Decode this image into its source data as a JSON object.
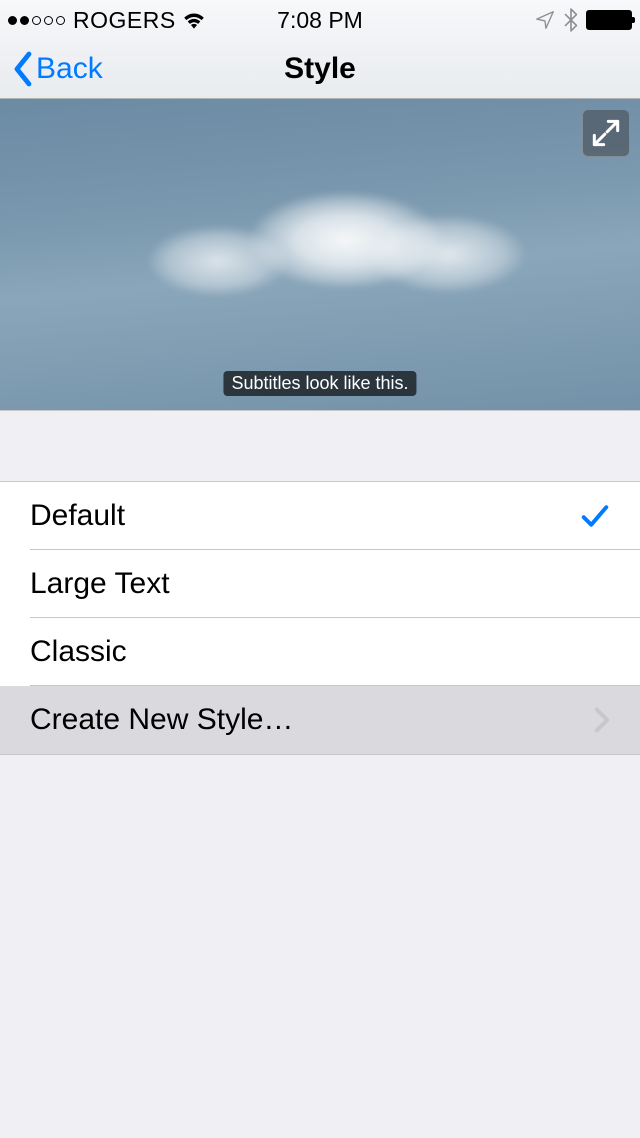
{
  "status": {
    "carrier": "ROGERS",
    "time": "7:08 PM"
  },
  "nav": {
    "back_label": "Back",
    "title": "Style"
  },
  "preview": {
    "subtitle_sample": "Subtitles look like this."
  },
  "styles": {
    "options": [
      {
        "label": "Default",
        "selected": true
      },
      {
        "label": "Large Text",
        "selected": false
      },
      {
        "label": "Classic",
        "selected": false
      }
    ],
    "create_label": "Create New Style…"
  }
}
